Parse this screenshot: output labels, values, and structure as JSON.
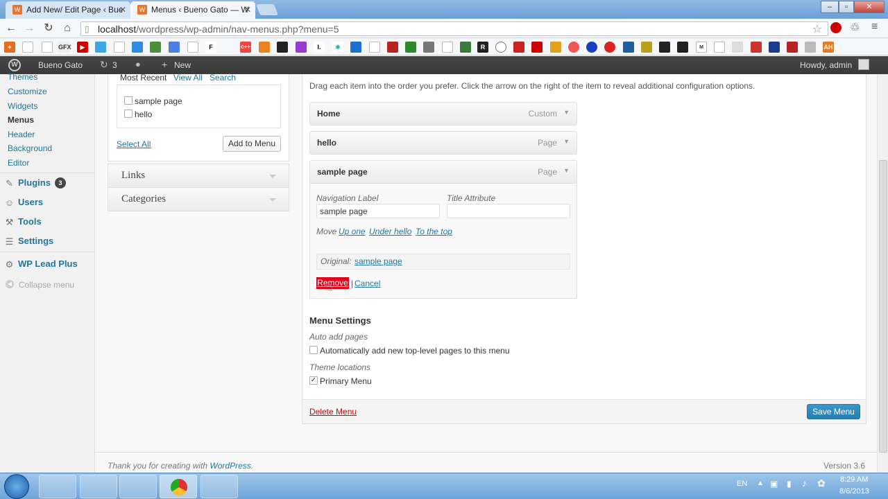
{
  "browser": {
    "tabs": [
      {
        "title": "Add New/ Edit Page ‹ Bue"
      },
      {
        "title": "Menus ‹ Bueno Gato — W"
      }
    ],
    "url_host": "localhost",
    "url_path": "/wordpress/wp-admin/nav-menus.php?menu=5",
    "bookmark_labels": [
      "GFX",
      "F",
      "R",
      "I.",
      "M",
      "E",
      "AH"
    ]
  },
  "adminbar": {
    "site_name": "Bueno Gato",
    "updates_count": "3",
    "new_label": "New",
    "greeting": "Howdy, admin"
  },
  "sidebar": {
    "submenu": [
      "Themes",
      "Customize",
      "Widgets",
      "Menus",
      "Header",
      "Background",
      "Editor"
    ],
    "menu": [
      {
        "label": "Plugins",
        "badge": "3"
      },
      {
        "label": "Users"
      },
      {
        "label": "Tools"
      },
      {
        "label": "Settings"
      },
      {
        "label": "WP Lead Plus"
      }
    ],
    "collapse": "Collapse menu"
  },
  "pages_box": {
    "tabs": [
      "Most Recent",
      "View All",
      "Search"
    ],
    "items": [
      "sample page",
      "hello"
    ],
    "select_all": "Select All",
    "add_button": "Add to Menu"
  },
  "accordions": [
    "Links",
    "Categories"
  ],
  "menu_edit": {
    "instructions": "Drag each item into the order you prefer. Click the arrow on the right of the item to reveal additional configuration options.",
    "items": [
      {
        "title": "Home",
        "type": "Custom"
      },
      {
        "title": "hello",
        "type": "Page"
      },
      {
        "title": "sample page",
        "type": "Page"
      }
    ],
    "nav_label_caption": "Navigation Label",
    "nav_label_value": "sample page",
    "title_attr_caption": "Title Attribute",
    "title_attr_value": "",
    "move_label": "Move",
    "move_links": [
      "Up one",
      "Under hello",
      "To the top"
    ],
    "original_label": "Original:",
    "original_link": "sample page",
    "remove": "Remove",
    "separator": "|",
    "cancel": "Cancel"
  },
  "menu_settings": {
    "heading": "Menu Settings",
    "auto_add_caption": "Auto add pages",
    "auto_add_label": "Automatically add new top-level pages to this menu",
    "theme_locations_caption": "Theme locations",
    "primary_label": "Primary Menu",
    "primary_checked": true
  },
  "footer_actions": {
    "delete": "Delete Menu",
    "save": "Save Menu"
  },
  "footer": {
    "thanks": "Thank you for creating with ",
    "wp_link": "WordPress",
    "period": ".",
    "version": "Version 3.6"
  },
  "taskbar": {
    "lang": "EN",
    "time": "8:29 AM",
    "date": "8/6/2013"
  },
  "colors": {
    "link": "#21759b",
    "save_button": "#2e86b8",
    "remove_highlight": "#e0001a",
    "adminbar": "#464646"
  }
}
